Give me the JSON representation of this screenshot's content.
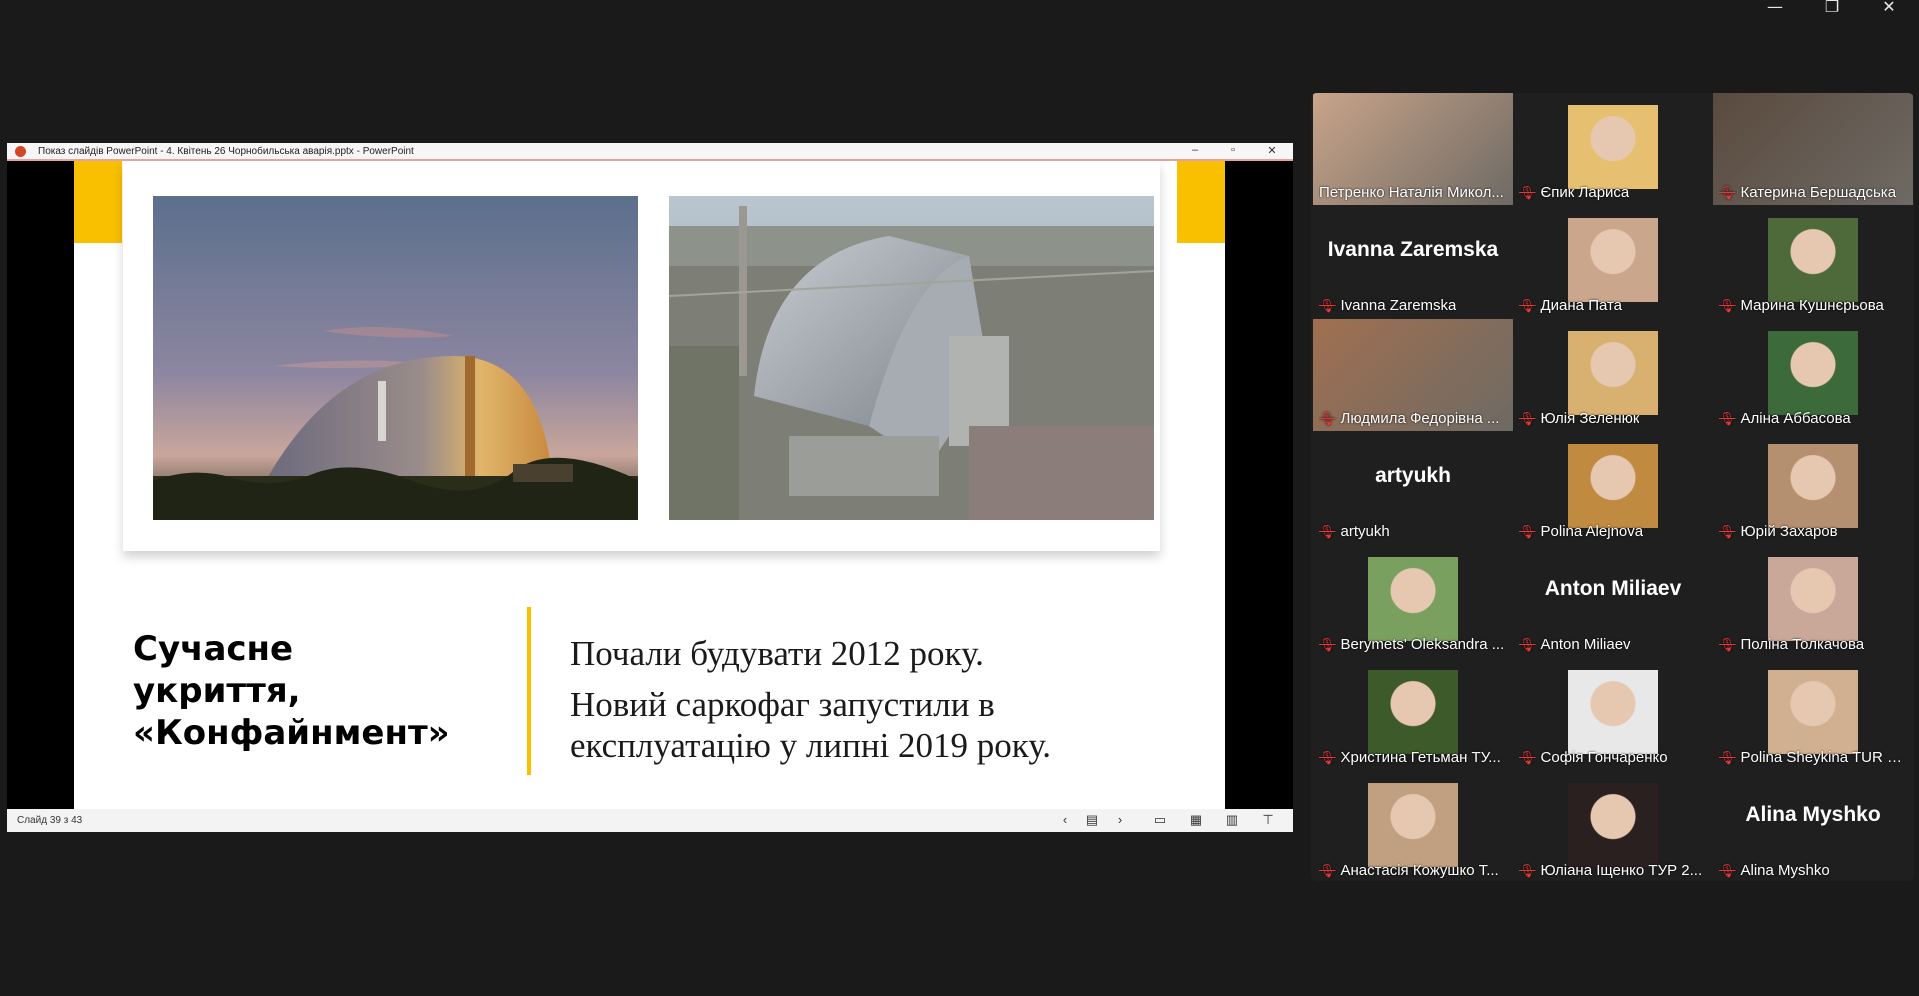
{
  "window_controls": {
    "minimize": "—",
    "restore": "❐",
    "close": "✕"
  },
  "ppt": {
    "title": "Показ слайдів PowerPoint  -  4. Квітень 26 Чорнобильська аварія.pptx - PowerPoint",
    "status": "Слайд 39 з 43",
    "slide": {
      "heading": [
        "Сучасне",
        "укриття,",
        "«Конфайнмент»"
      ],
      "body": [
        "Почали будувати 2012 року.",
        "Новий саркофаг запустили в",
        "експлуатацію у липні 2019 року."
      ]
    }
  },
  "participants": [
    {
      "name": "Петренко Наталія Микол...",
      "muted": false,
      "video": true,
      "active": true
    },
    {
      "name": "Єпик Лариса",
      "muted": true,
      "video": true
    },
    {
      "name": "Катерина Бершадська",
      "muted": true,
      "video": true
    },
    {
      "name": "Ivanna Zaremska",
      "muted": true,
      "video": false,
      "big": "Ivanna Zaremska"
    },
    {
      "name": "Диана Пата",
      "muted": true,
      "video": true
    },
    {
      "name": "Марина Кушнєрьова",
      "muted": true,
      "video": true
    },
    {
      "name": "Людмила Федорівна ...",
      "muted": true,
      "video": true
    },
    {
      "name": "Юлія Зеленюк",
      "muted": true,
      "video": true
    },
    {
      "name": "Аліна Аббасова",
      "muted": true,
      "video": true
    },
    {
      "name": "artyukh",
      "muted": true,
      "video": false,
      "big": "artyukh"
    },
    {
      "name": "Polina Alejnova",
      "muted": true,
      "video": true
    },
    {
      "name": "Юрій Захаров",
      "muted": true,
      "video": true
    },
    {
      "name": "Berymets' Oleksandra ...",
      "muted": true,
      "video": true
    },
    {
      "name": "Anton Miliaev",
      "muted": true,
      "video": false,
      "big": "Anton Miliaev"
    },
    {
      "name": "Поліна Толкачова",
      "muted": true,
      "video": true
    },
    {
      "name": "Христина Гетьман ТУ...",
      "muted": true,
      "video": true
    },
    {
      "name": "Софія Гончаренко",
      "muted": true,
      "video": true
    },
    {
      "name": "Polina Sheykina TUR 2...",
      "muted": true,
      "video": true
    },
    {
      "name": "Анастасія Кожушко Т...",
      "muted": true,
      "video": true
    },
    {
      "name": "Юліана Іщенко ТУР 2...",
      "muted": true,
      "video": true
    },
    {
      "name": "Alina Myshko",
      "muted": true,
      "video": false,
      "big": "Alina Myshko"
    }
  ]
}
